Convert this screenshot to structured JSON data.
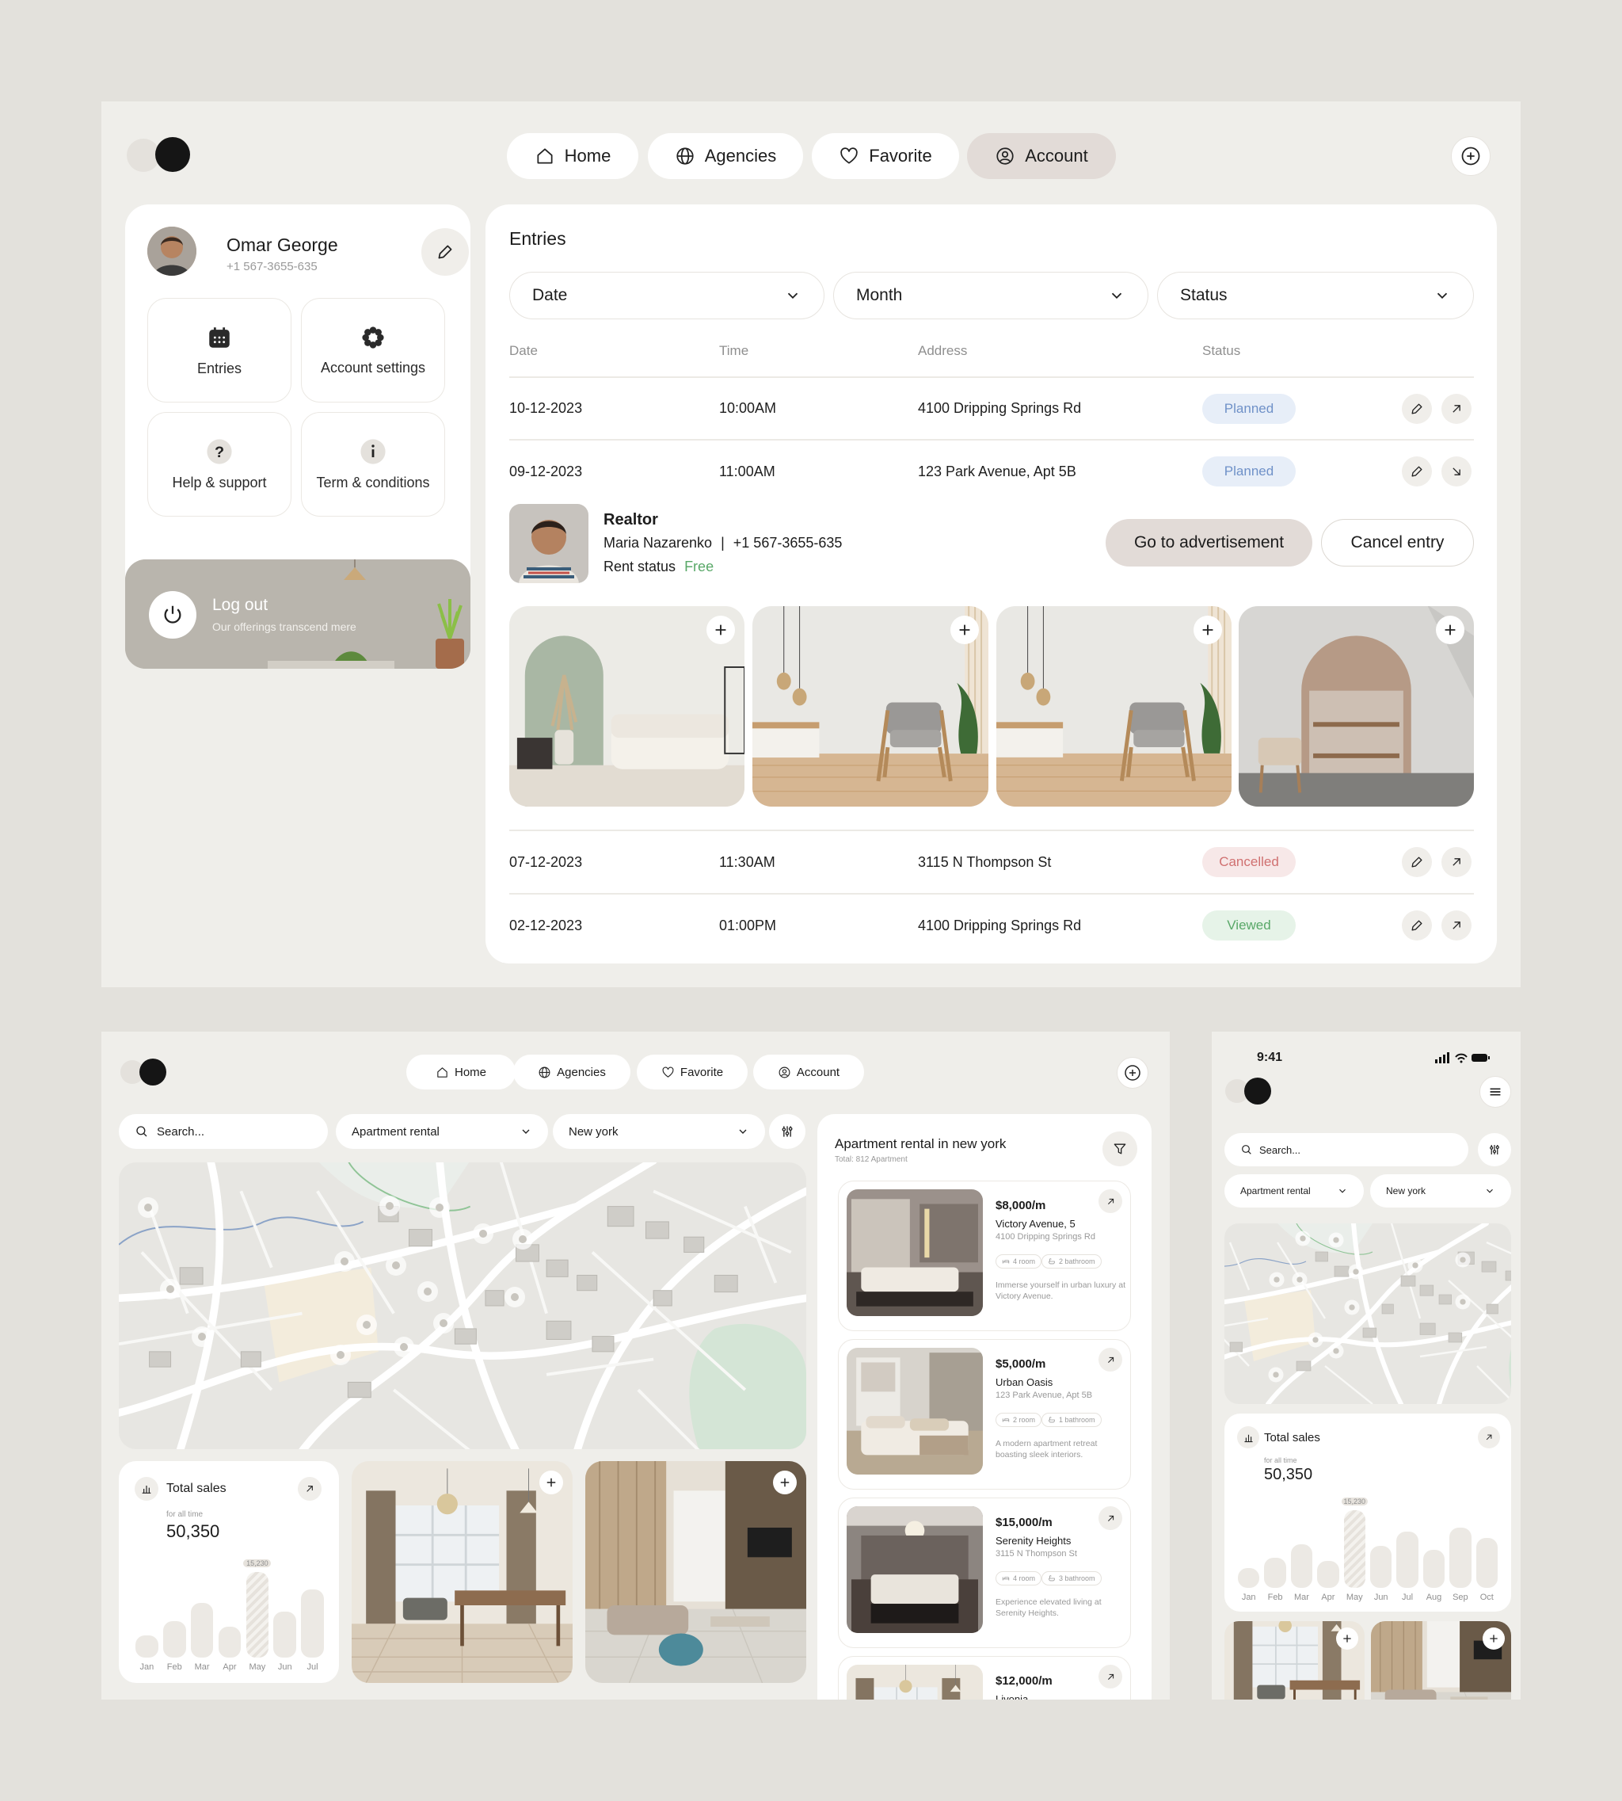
{
  "nav": {
    "home": "Home",
    "agencies": "Agencies",
    "favorite": "Favorite",
    "account": "Account"
  },
  "profile": {
    "name": "Omar George",
    "phone": "+1 567-3655-635"
  },
  "tiles": {
    "entries": "Entries",
    "account_settings": "Account settings",
    "help": "Help & support",
    "terms": "Term & conditions"
  },
  "logout": {
    "title": "Log out",
    "subtitle": "Our offerings transcend mere"
  },
  "entries": {
    "title": "Entries",
    "filters": {
      "date": "Date",
      "month": "Month",
      "status": "Status"
    },
    "columns": {
      "date": "Date",
      "time": "Time",
      "address": "Address",
      "status": "Status"
    },
    "rows": [
      {
        "date": "10-12-2023",
        "time": "10:00AM",
        "address": "4100 Dripping Springs Rd",
        "status": "Planned"
      },
      {
        "date": "09-12-2023",
        "time": "11:00AM",
        "address": "123 Park Avenue, Apt 5B",
        "status": "Planned"
      },
      {
        "date": "07-12-2023",
        "time": "11:30AM",
        "address": "3115 N Thompson St",
        "status": "Cancelled"
      },
      {
        "date": "02-12-2023",
        "time": "01:00PM",
        "address": "4100 Dripping Springs Rd",
        "status": "Viewed"
      }
    ],
    "realtor": {
      "title": "Realtor",
      "name": "Maria Nazarenko",
      "separator": "|",
      "phone": "+1 567-3655-635",
      "rent_label": "Rent status",
      "rent_value": "Free",
      "go_button": "Go to advertisement",
      "cancel_button": "Cancel entry"
    }
  },
  "map_screen": {
    "search_placeholder": "Search...",
    "type_select": "Apartment rental",
    "city_select": "New york",
    "sales": {
      "title": "Total sales",
      "subtitle": "for all time",
      "value": "50,350",
      "peak_label": "15,230"
    },
    "chart_months": [
      "Jan",
      "Feb",
      "Mar",
      "Apr",
      "May",
      "Jun",
      "Jul"
    ],
    "listing_header": {
      "title": "Apartment rental in new york",
      "total": "Total: 812 Apartment"
    },
    "listings": [
      {
        "price": "$8,000/m",
        "name": "Victory Avenue, 5",
        "address": "4100 Dripping Springs Rd",
        "rooms": "4 room",
        "baths": "2 bathroom",
        "desc": "Immerse yourself in urban luxury at Victory Avenue."
      },
      {
        "price": "$5,000/m",
        "name": "Urban Oasis",
        "address": "123 Park Avenue, Apt 5B",
        "rooms": "2 room",
        "baths": "1 bathroom",
        "desc": "A modern apartment retreat boasting sleek interiors."
      },
      {
        "price": "$15,000/m",
        "name": "Serenity Heights",
        "address": "3115 N Thompson St",
        "rooms": "4 room",
        "baths": "3 bathroom",
        "desc": "Experience elevated living at Serenity Heights."
      },
      {
        "price": "$12,000/m",
        "name": "Livonia",
        "address": "",
        "rooms": "",
        "baths": "",
        "desc": ""
      }
    ]
  },
  "mobile": {
    "time": "9:41",
    "search_placeholder": "Search...",
    "type_select": "Apartment rental",
    "city_select": "New york",
    "sales": {
      "title": "Total sales",
      "subtitle": "for all time",
      "value": "50,350",
      "peak_label": "15,230"
    },
    "chart_months": [
      "Jan",
      "Feb",
      "Mar",
      "Apr",
      "May",
      "Jun",
      "Jul",
      "Aug",
      "Sep",
      "Oct"
    ]
  },
  "colors": {
    "accent_pill": "#e2dbd7",
    "planned": "#6f91c8",
    "cancelled": "#d07070",
    "viewed": "#59a868",
    "free": "#59a868"
  }
}
